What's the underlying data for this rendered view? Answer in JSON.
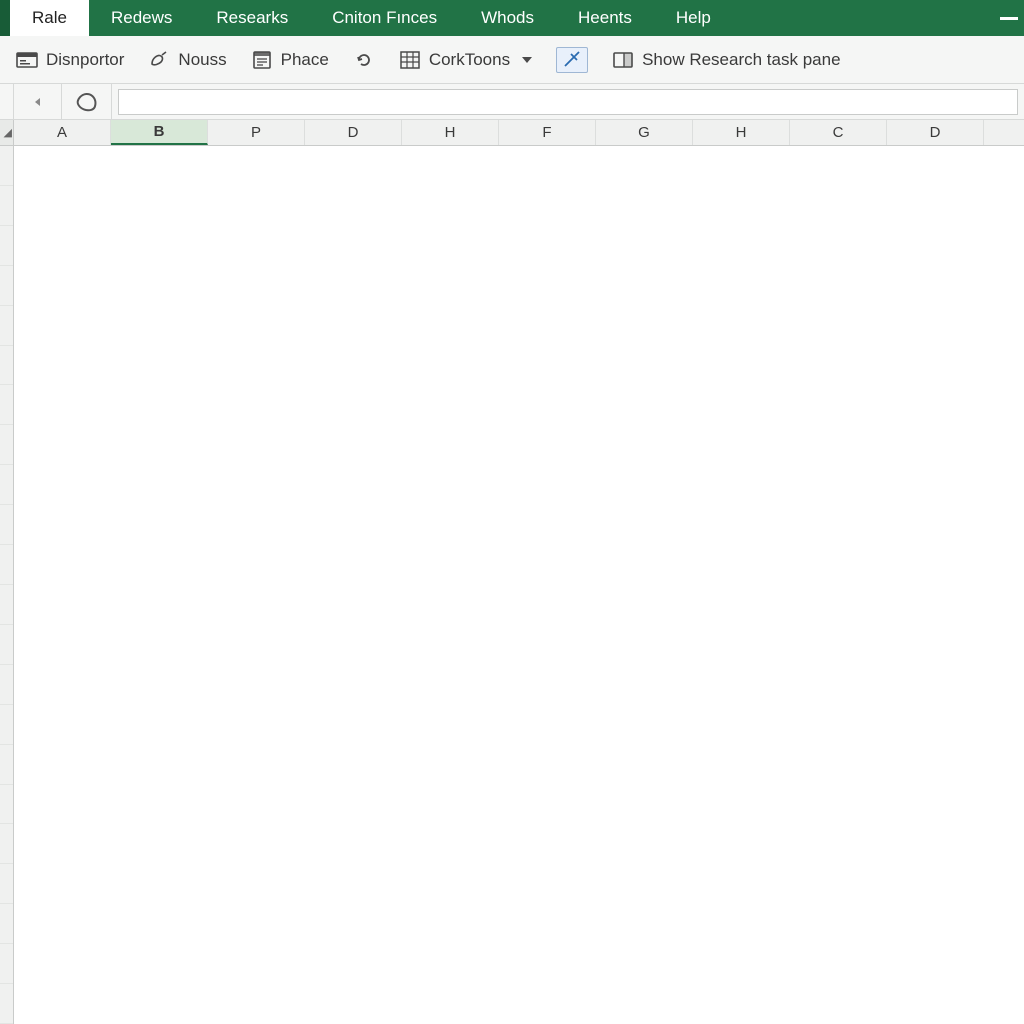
{
  "colors": {
    "brand_green": "#217346",
    "toolbar_bg": "#f5f6f5",
    "header_bg": "#f0f1f0"
  },
  "ribbon": {
    "active_tab": "Rale",
    "tabs": [
      "Rale",
      "Redews",
      "Researks",
      "Cniton Fınces",
      "Whods",
      "Heents",
      "Help"
    ]
  },
  "toolbar": {
    "disnportor": "Disnportor",
    "nouss": "Nouss",
    "phace": "Phace",
    "corktoons": "CorkToons",
    "show_research": "Show Research task pane"
  },
  "formula_bar": {
    "value": ""
  },
  "columns": [
    "A",
    "B",
    "P",
    "D",
    "H",
    "F",
    "G",
    "H",
    "C",
    "D"
  ],
  "selected_column_index": 1,
  "row_count": 22
}
